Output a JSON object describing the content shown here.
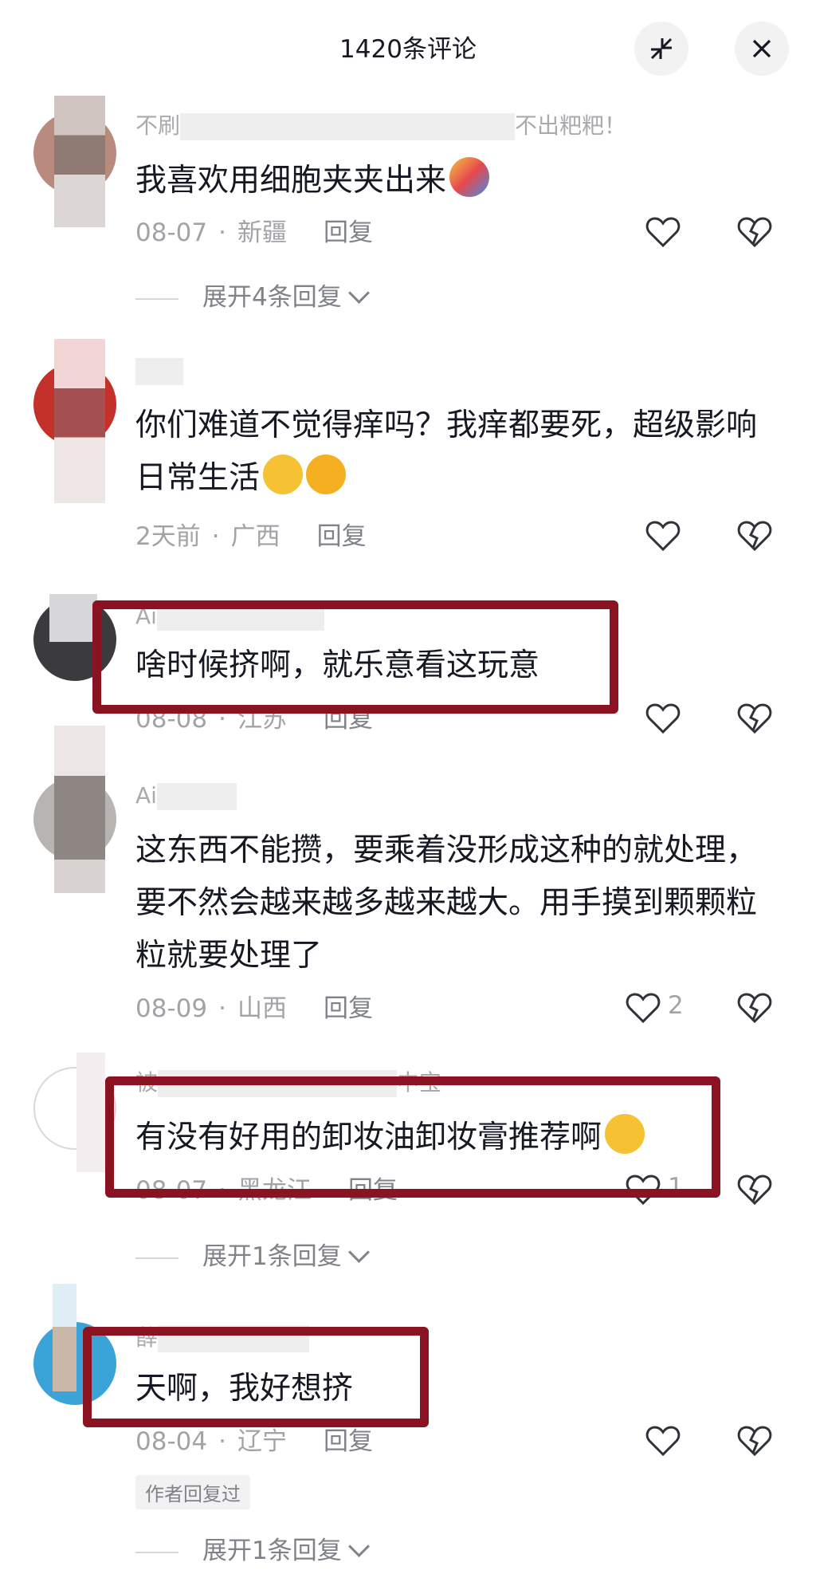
{
  "header": {
    "title": "1420条评论",
    "collapse_icon": "collapse-icon",
    "close_icon": "close-icon"
  },
  "comments": [
    {
      "username_start": "不刷",
      "username_end": "不出粑粑！",
      "text": "我喜欢用细胞夹夹出来",
      "date": "08-07",
      "region": "新疆",
      "reply": "回复",
      "likes": "",
      "expand": "展开4条回复"
    },
    {
      "username_start": "",
      "username_end": "",
      "text": "你们难道不觉得痒吗？我痒都要死，超级影响日常生活",
      "date": "2天前",
      "region": "广西",
      "reply": "回复",
      "likes": ""
    },
    {
      "username_start": "Ai",
      "username_end": "",
      "text": "啥时候挤啊，就乐意看这玩意",
      "date": "08-08",
      "region": "江苏",
      "reply": "回复",
      "likes": ""
    },
    {
      "username_start": "Ai",
      "username_end": "",
      "text": "这东西不能攒，要乘着没形成这种的就处理，要不然会越来越多越来越大。用手摸到颗颗粒粒就要处理了",
      "date": "08-09",
      "region": "山西",
      "reply": "回复",
      "likes": "2"
    },
    {
      "username_start": "被",
      "username_end": "中宝",
      "text": "有没有好用的卸妆油卸妆膏推荐啊",
      "date": "08-07",
      "region": "黑龙江",
      "reply": "回复",
      "likes": "1",
      "expand": "展开1条回复"
    },
    {
      "username_start": "薛",
      "username_end": "",
      "text": "天啊，我好想挤",
      "date": "08-04",
      "region": "辽宁",
      "reply": "回复",
      "likes": "",
      "author_tag": "作者回复过",
      "expand": "展开1条回复"
    }
  ],
  "colors": {
    "highlight_box": "#8b1220",
    "meta_text": "#a2a3a7",
    "main_text": "#161823"
  }
}
